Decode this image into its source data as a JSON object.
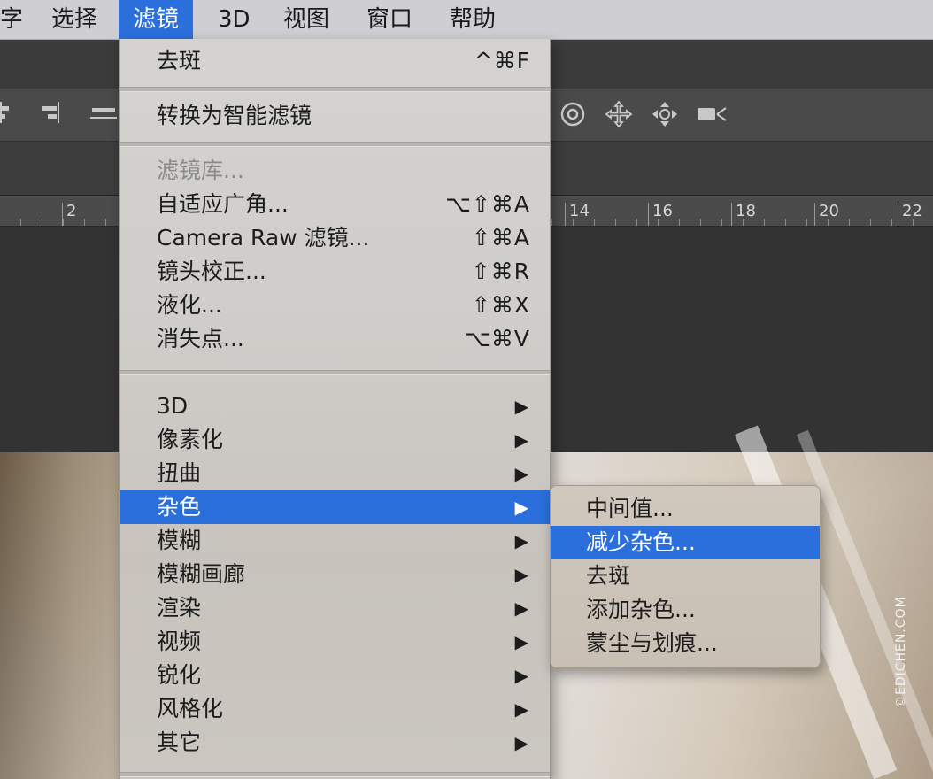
{
  "menubar": {
    "items": [
      {
        "label": "字"
      },
      {
        "label": "选择"
      },
      {
        "label": "滤镜"
      },
      {
        "label": "3D"
      },
      {
        "label": "视图"
      },
      {
        "label": "窗口"
      },
      {
        "label": "帮助"
      }
    ]
  },
  "ruler": {
    "ticks": [
      "2",
      "14",
      "16",
      "18",
      "20",
      "22"
    ]
  },
  "filter_menu": {
    "items": [
      {
        "label": "去斑",
        "shortcut": "^⌘F"
      },
      {
        "label": "转换为智能滤镜",
        "shortcut": ""
      },
      {
        "label": "滤镜库...",
        "shortcut": ""
      },
      {
        "label": "自适应广角...",
        "shortcut": "⌥⇧⌘A"
      },
      {
        "label": "Camera Raw 滤镜...",
        "shortcut": "⇧⌘A"
      },
      {
        "label": "镜头校正...",
        "shortcut": "⇧⌘R"
      },
      {
        "label": "液化...",
        "shortcut": "⇧⌘X"
      },
      {
        "label": "消失点...",
        "shortcut": "⌥⌘V"
      },
      {
        "label": "3D"
      },
      {
        "label": "像素化"
      },
      {
        "label": "扭曲"
      },
      {
        "label": "杂色"
      },
      {
        "label": "模糊"
      },
      {
        "label": "模糊画廊"
      },
      {
        "label": "渲染"
      },
      {
        "label": "视频"
      },
      {
        "label": "锐化"
      },
      {
        "label": "风格化"
      },
      {
        "label": "其它"
      }
    ],
    "submenu_arrow": "▶"
  },
  "noise_submenu": {
    "items": [
      {
        "label": "中间值..."
      },
      {
        "label": "减少杂色..."
      },
      {
        "label": "去斑"
      },
      {
        "label": "添加杂色..."
      },
      {
        "label": "蒙尘与划痕..."
      }
    ]
  },
  "watermark": "©EDICHEN.COM",
  "colors": {
    "highlight": "#2a6fdb",
    "menu_bg": "#d2d0cd"
  },
  "icons": [
    "align-center-icon",
    "align-right-icon",
    "align-bottom-icon",
    "orbit-3d-icon",
    "pan-3d-icon",
    "slide-3d-icon",
    "camera-3d-icon"
  ]
}
